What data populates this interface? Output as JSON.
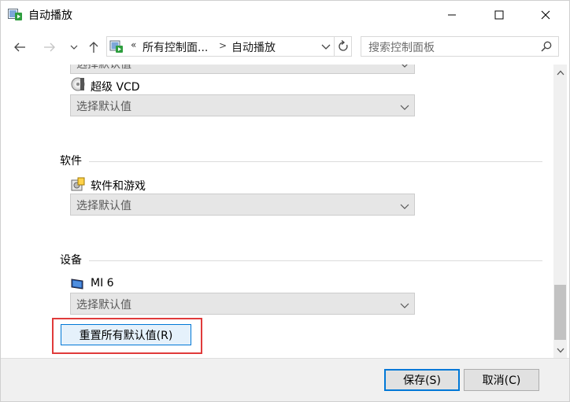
{
  "window": {
    "title": "自动播放"
  },
  "nav": {
    "crumb_overflow": "«",
    "crumb_parent": "所有控制面...",
    "crumb_sep": ">",
    "crumb_current": "自动播放"
  },
  "search": {
    "placeholder": "搜索控制面板"
  },
  "items": {
    "partial_select_value": "选择默认值",
    "super_vcd": {
      "label": "超级 VCD",
      "value": "选择默认值"
    },
    "software_section": "软件",
    "software_games": {
      "label": "软件和游戏",
      "value": "选择默认值"
    },
    "devices_section": "设备",
    "mi6": {
      "label": "MI 6",
      "value": "选择默认值"
    }
  },
  "reset_button": "重置所有默认值(R)",
  "footer": {
    "save": "保存(S)",
    "cancel": "取消(C)"
  }
}
